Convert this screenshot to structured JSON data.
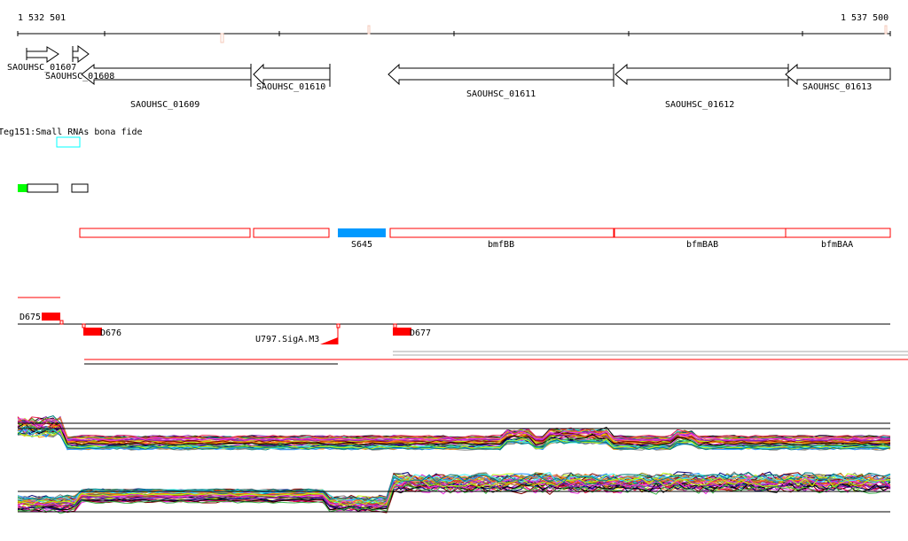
{
  "ruler": {
    "start": "1 532 501",
    "end": "1 537 500"
  },
  "genes": [
    {
      "name": "SAOUHSC_01607"
    },
    {
      "name": "SAOUHSC_01608"
    },
    {
      "name": "SAOUHSC_01609"
    },
    {
      "name": "SAOUHSC_01610"
    },
    {
      "name": "SAOUHSC_01611"
    },
    {
      "name": "SAOUHSC_01612"
    },
    {
      "name": "SAOUHSC_01613"
    }
  ],
  "small_rna_track": {
    "label": "Teg151:Small RNAs bona fide"
  },
  "operons": [
    {
      "label": "S645"
    },
    {
      "label": "bmfBB"
    },
    {
      "label": "bfmBAB"
    },
    {
      "label": "bfmBAA"
    }
  ],
  "promoters": [
    {
      "label": "D675"
    },
    {
      "label": "D676"
    },
    {
      "label": "U797.SigA.M3"
    },
    {
      "label": "D677"
    }
  ],
  "colors": {
    "gene_red": "#ff0000",
    "segment_blue": "#0099ff",
    "srna_cyan": "#00ffff",
    "green": "#00ff00"
  }
}
